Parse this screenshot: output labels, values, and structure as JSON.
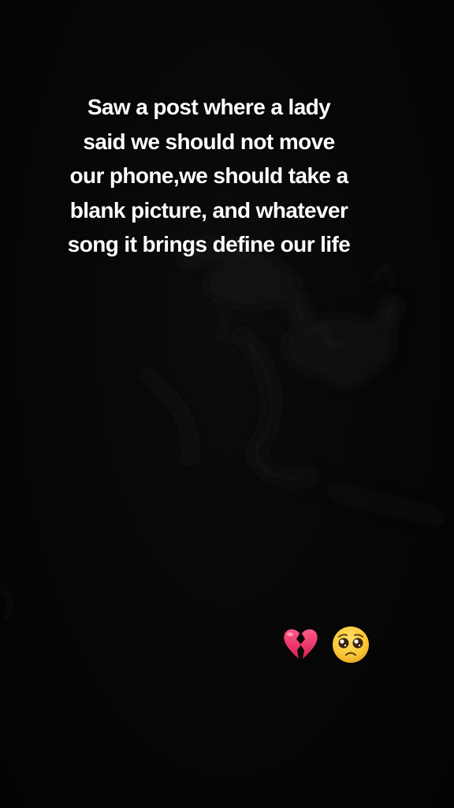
{
  "caption": {
    "lines": [
      "Saw a post where a lady",
      "said we should not move",
      "our phone,we should take a",
      "blank picture, and whatever",
      "song it brings define our life"
    ]
  },
  "emojis": [
    {
      "icon": "broken-heart-icon",
      "color": "#e8336a"
    },
    {
      "icon": "pleading-face-icon",
      "color": "#f6c23a"
    }
  ],
  "colors": {
    "background": "#050505",
    "text": "#ffffff"
  }
}
